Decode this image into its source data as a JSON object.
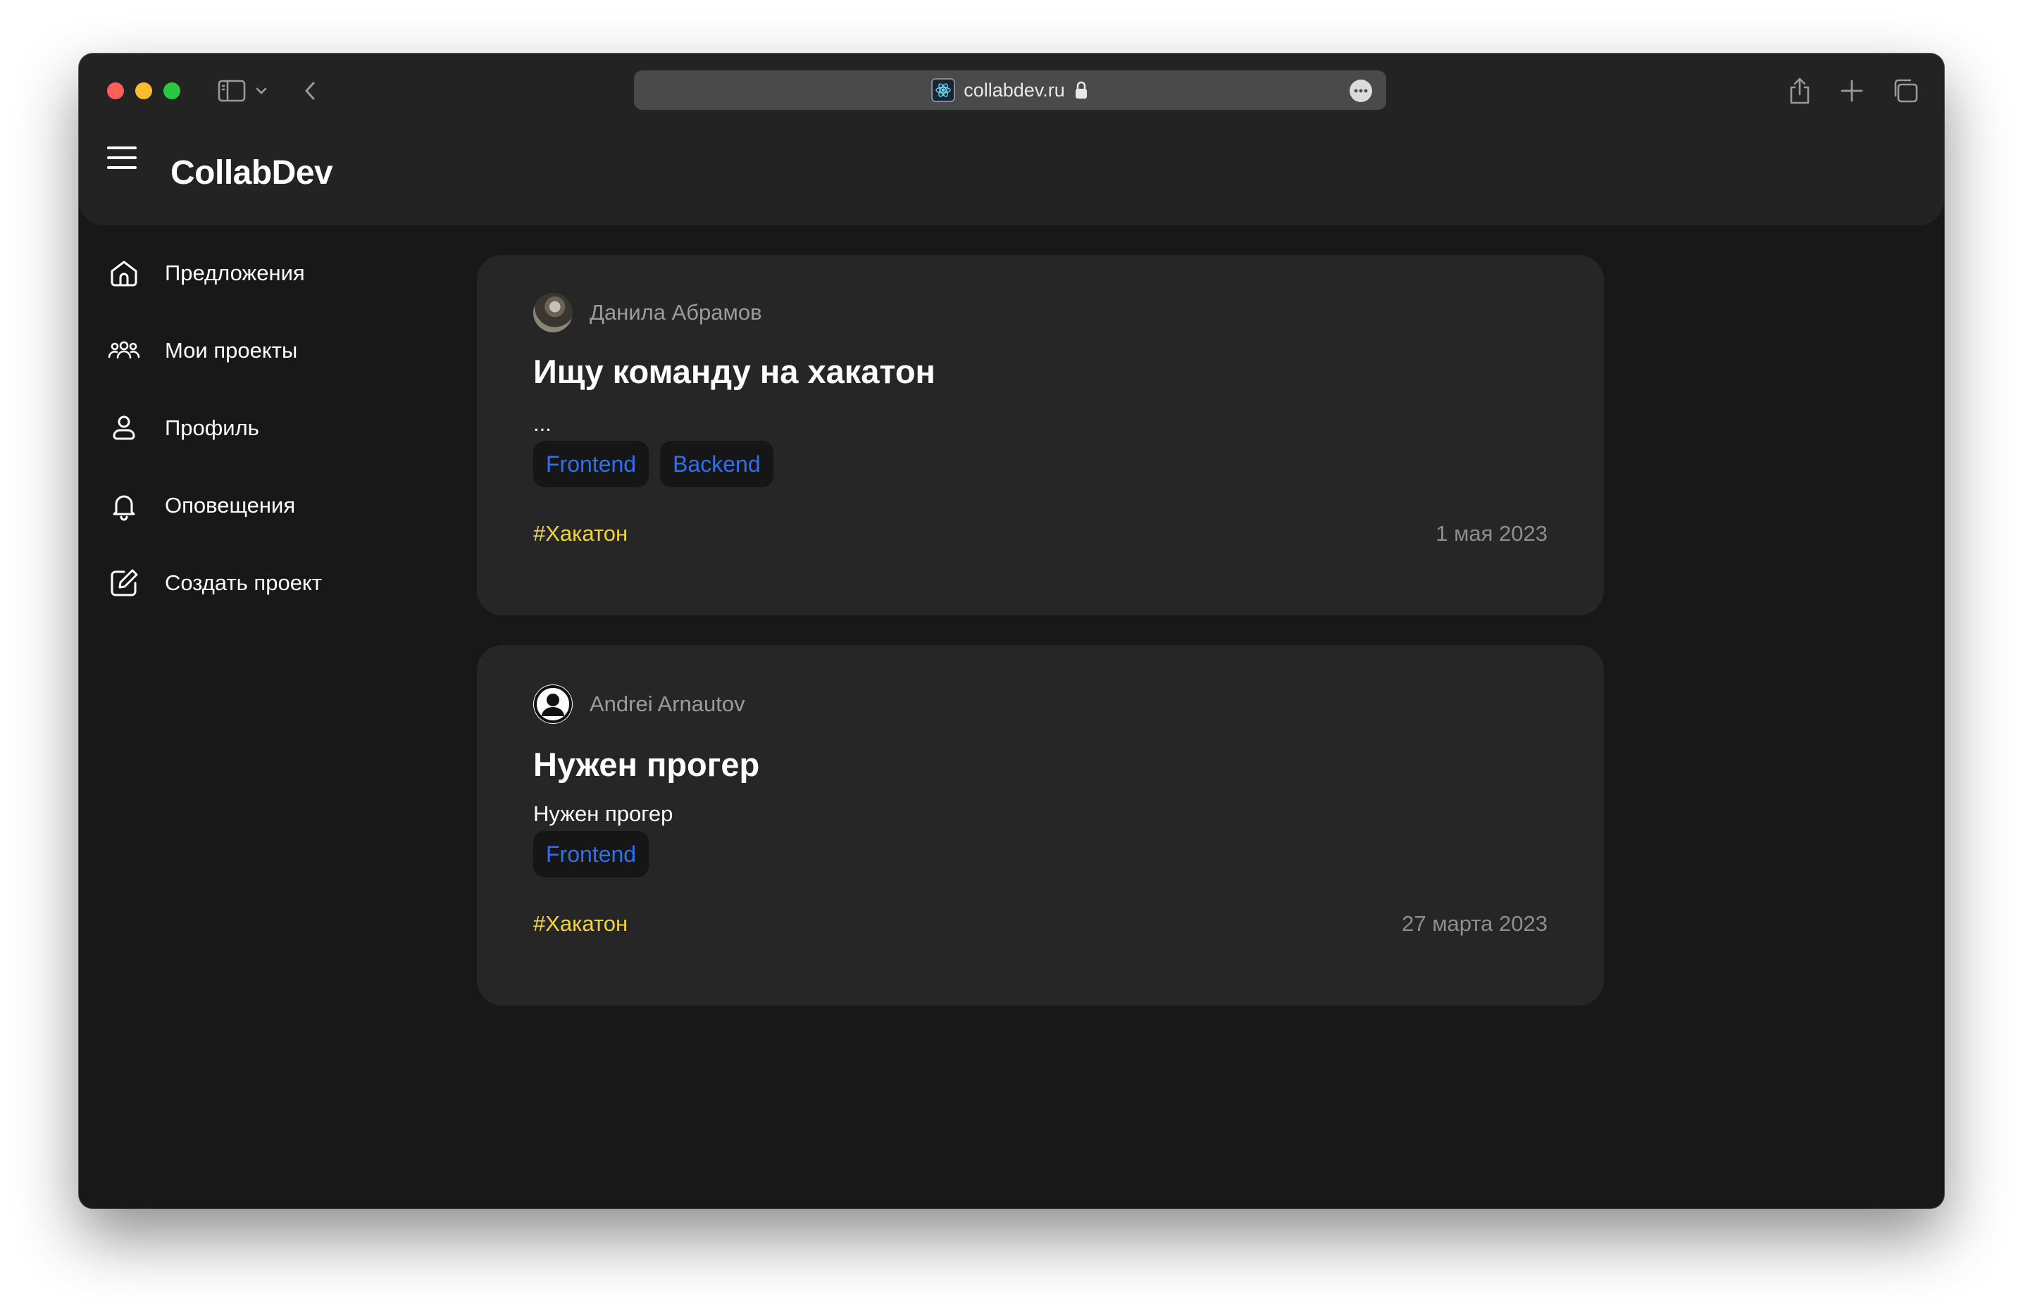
{
  "browser": {
    "url": "collabdev.ru"
  },
  "app": {
    "brand": "CollabDev"
  },
  "sidebar": {
    "items": [
      {
        "label": "Предложения",
        "icon": "home-icon"
      },
      {
        "label": "Мои проекты",
        "icon": "users-icon"
      },
      {
        "label": "Профиль",
        "icon": "user-icon"
      },
      {
        "label": "Оповещения",
        "icon": "bell-icon"
      },
      {
        "label": "Создать проект",
        "icon": "edit-square-icon"
      }
    ]
  },
  "posts": [
    {
      "author": "Данила Абрамов",
      "title": "Ищу команду на хакатон",
      "description": "...",
      "tags": [
        "Frontend",
        "Backend"
      ],
      "hashtag": "#Хакатон",
      "date": "1 мая 2023"
    },
    {
      "author": "Andrei Arnautov",
      "title": "Нужен прогер",
      "description": "Нужен прогер",
      "tags": [
        "Frontend"
      ],
      "hashtag": "#Хакатон",
      "date": "27 марта 2023"
    }
  ],
  "colors": {
    "background": "#181818",
    "card": "#262626",
    "tag_text": "#2f6ff0",
    "hashtag": "#f0d43a",
    "muted_text": "#9b9b9b"
  }
}
